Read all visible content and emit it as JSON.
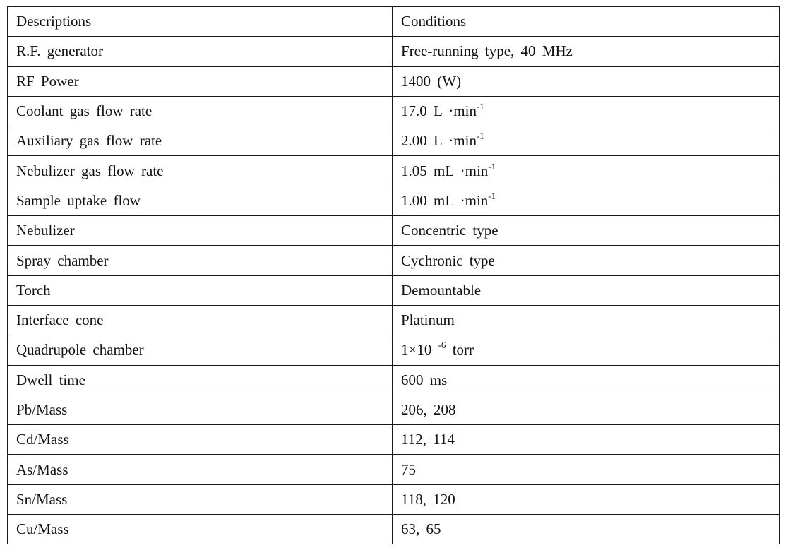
{
  "table": {
    "headers": [
      "Descriptions",
      "Conditions"
    ],
    "rows": [
      {
        "description": "R.F. generator",
        "condition": "Free-running type, 40 MHz",
        "sup": "",
        "suffix": ""
      },
      {
        "description": "RF Power",
        "condition": "1400 (W)",
        "sup": "",
        "suffix": ""
      },
      {
        "description": "Coolant gas flow rate",
        "condition": "17.0 L ·min",
        "sup": "-1",
        "suffix": ""
      },
      {
        "description": "Auxiliary gas flow rate",
        "condition": "2.00 L ·min",
        "sup": "-1",
        "suffix": ""
      },
      {
        "description": "Nebulizer gas flow rate",
        "condition": "1.05 mL ·min",
        "sup": "-1",
        "suffix": ""
      },
      {
        "description": "Sample uptake flow",
        "condition": "1.00 mL ·min",
        "sup": "-1",
        "suffix": ""
      },
      {
        "description": "Nebulizer",
        "condition": "Concentric type",
        "sup": "",
        "suffix": ""
      },
      {
        "description": "Spray chamber",
        "condition": "Cychronic type",
        "sup": "",
        "suffix": ""
      },
      {
        "description": "Torch",
        "condition": "Demountable",
        "sup": "",
        "suffix": ""
      },
      {
        "description": "Interface cone",
        "condition": "Platinum",
        "sup": "",
        "suffix": ""
      },
      {
        "description": "Quadrupole chamber",
        "condition": "1×10 ",
        "sup": "-6",
        "suffix": " torr"
      },
      {
        "description": "Dwell time",
        "condition": "600 ms",
        "sup": "",
        "suffix": ""
      },
      {
        "description": "Pb/Mass",
        "condition": "206, 208",
        "sup": "",
        "suffix": ""
      },
      {
        "description": "Cd/Mass",
        "condition": "112, 114",
        "sup": "",
        "suffix": ""
      },
      {
        "description": "As/Mass",
        "condition": "75",
        "sup": "",
        "suffix": ""
      },
      {
        "description": "Sn/Mass",
        "condition": "118, 120",
        "sup": "",
        "suffix": ""
      },
      {
        "description": "Cu/Mass",
        "condition": "63, 65",
        "sup": "",
        "suffix": ""
      }
    ]
  }
}
